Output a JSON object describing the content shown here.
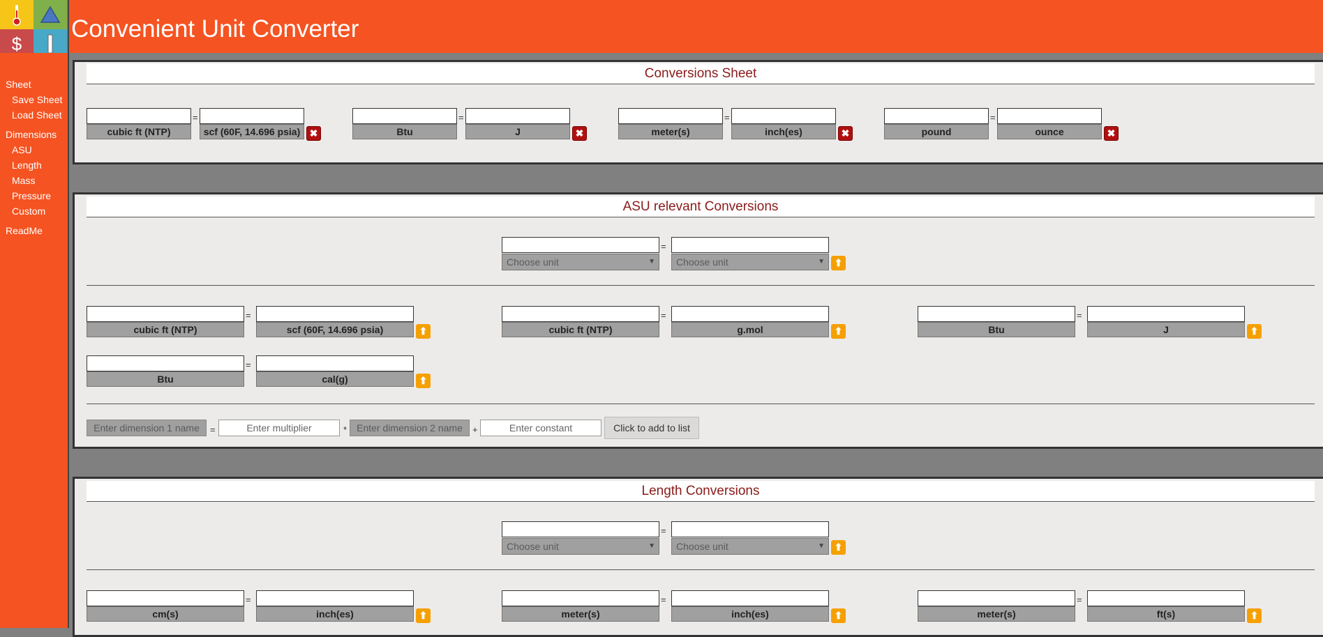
{
  "app": {
    "title": "Convenient Unit Converter"
  },
  "logo_icons": [
    "thermometer-icon",
    "triangle-icon",
    "dollar-icon",
    "bar-icon"
  ],
  "colors": {
    "accent": "#F55321",
    "panel_title": "#8B1A1A",
    "delete": "#B01010",
    "promote": "#F5A000"
  },
  "sidebar": {
    "sheet": "Sheet",
    "save": "Save Sheet",
    "load": "Load Sheet",
    "dimensions": "Dimensions",
    "asu": "ASU",
    "length": "Length",
    "mass": "Mass",
    "pressure": "Pressure",
    "custom": "Custom",
    "readme": "ReadMe"
  },
  "sheet": {
    "title": "Conversions Sheet",
    "pairs": [
      {
        "left": "cubic ft (NTP)",
        "right": "scf (60F, 14.696 psia)"
      },
      {
        "left": "Btu",
        "right": "J"
      },
      {
        "left": "meter(s)",
        "right": "inch(es)"
      },
      {
        "left": "pound",
        "right": "ounce"
      }
    ]
  },
  "asu": {
    "title": "ASU relevant Conversions",
    "chooser": {
      "left": "Choose unit",
      "right": "Choose unit"
    },
    "pairs": [
      {
        "left": "cubic ft (NTP)",
        "right": "scf (60F, 14.696 psia)"
      },
      {
        "left": "cubic ft (NTP)",
        "right": "g.mol"
      },
      {
        "left": "Btu",
        "right": "J"
      },
      {
        "left": "Btu",
        "right": "cal(g)"
      }
    ],
    "add_row": {
      "dim1_placeholder": "Enter dimension 1 name",
      "multiplier_placeholder": "Enter multiplier",
      "times": "*",
      "dim2_placeholder": "Enter dimension 2 name",
      "plus": "+",
      "constant_placeholder": "Enter constant",
      "button": "Click to add to list"
    }
  },
  "length": {
    "title": "Length Conversions",
    "chooser": {
      "left": "Choose unit",
      "right": "Choose unit"
    },
    "pairs": [
      {
        "left": "cm(s)",
        "right": "inch(es)"
      },
      {
        "left": "meter(s)",
        "right": "inch(es)"
      },
      {
        "left": "meter(s)",
        "right": "ft(s)"
      }
    ]
  },
  "symbols": {
    "equals": "=",
    "delete": "✖",
    "promote": "⬆",
    "arrow": "▼"
  }
}
